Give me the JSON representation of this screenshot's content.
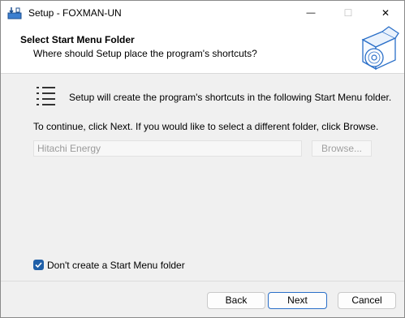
{
  "window": {
    "title": "Setup - FOXMAN-UN",
    "controls": {
      "minimize_icon": "minimize-icon",
      "maximize_icon": "maximize-icon",
      "close_icon": "close-icon",
      "minimize_glyph": "—",
      "maximize_glyph": "☐",
      "close_glyph": "✕"
    }
  },
  "header": {
    "title": "Select Start Menu Folder",
    "subtitle": "Where should Setup place the program's shortcuts?",
    "graphic_icon": "setup-box-disc-icon"
  },
  "content": {
    "intro_icon": "start-menu-list-icon",
    "intro_text": "Setup will create the program's shortcuts in the following Start Menu folder.",
    "continue_text": "To continue, click Next. If you would like to select a different folder, click Browse.",
    "folder_value": "Hitachi Energy",
    "browse_label": "Browse...",
    "checkbox_label": "Don't create a Start Menu folder",
    "checkbox_checked": true
  },
  "footer": {
    "back_label": "Back",
    "next_label": "Next",
    "cancel_label": "Cancel"
  },
  "colors": {
    "accent": "#1f5fa8",
    "default_button_border": "#2a6fc8",
    "dialog_background": "#f0f0f0"
  }
}
